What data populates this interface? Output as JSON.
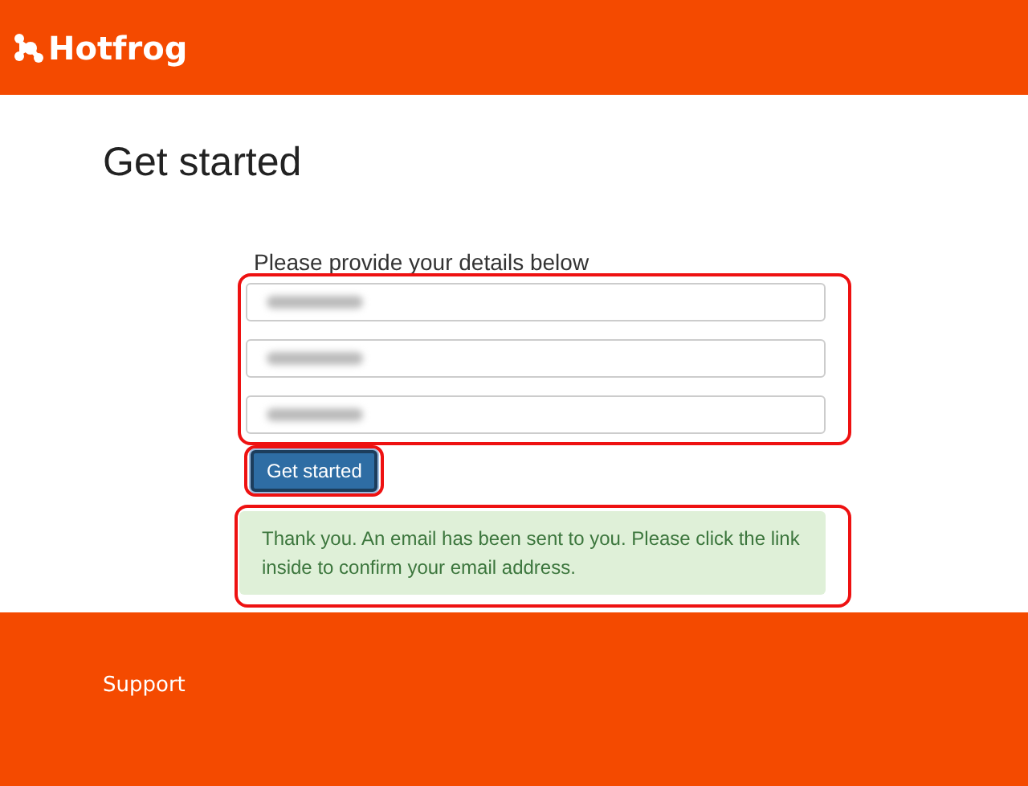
{
  "header": {
    "logo": "Hotfrog"
  },
  "page": {
    "title": "Get started"
  },
  "form": {
    "label": "Please provide your details below",
    "highlighted": true,
    "fields": [
      {
        "redacted": true
      },
      {
        "redacted": true
      },
      {
        "redacted": true
      }
    ],
    "button": {
      "label": "Get started",
      "highlighted": true
    },
    "message": {
      "text": "Thank you. An email has been sent to you. Please click the link inside to confirm your email address.",
      "highlighted": true
    }
  },
  "footer": {
    "links": [
      "Support"
    ]
  }
}
